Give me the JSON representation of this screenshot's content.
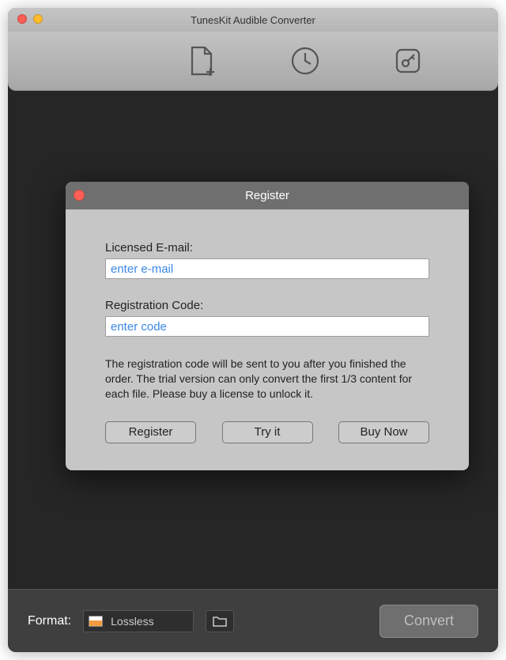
{
  "window": {
    "title": "TunesKit Audible Converter"
  },
  "toolbar": {
    "add_file": "add-file",
    "history": "history",
    "key": "key"
  },
  "footer": {
    "format_label": "Format:",
    "format_value": "Lossless",
    "convert_label": "Convert"
  },
  "dialog": {
    "title": "Register",
    "email_label": "Licensed E-mail:",
    "email_placeholder": "enter e-mail",
    "code_label": "Registration Code:",
    "code_placeholder": "enter code",
    "help_text": "The registration code will be sent to you after you finished the order. The trial version can only convert the first 1/3 content for each file. Please buy a license to unlock it.",
    "register_btn": "Register",
    "try_btn": "Try it",
    "buy_btn": "Buy Now"
  }
}
